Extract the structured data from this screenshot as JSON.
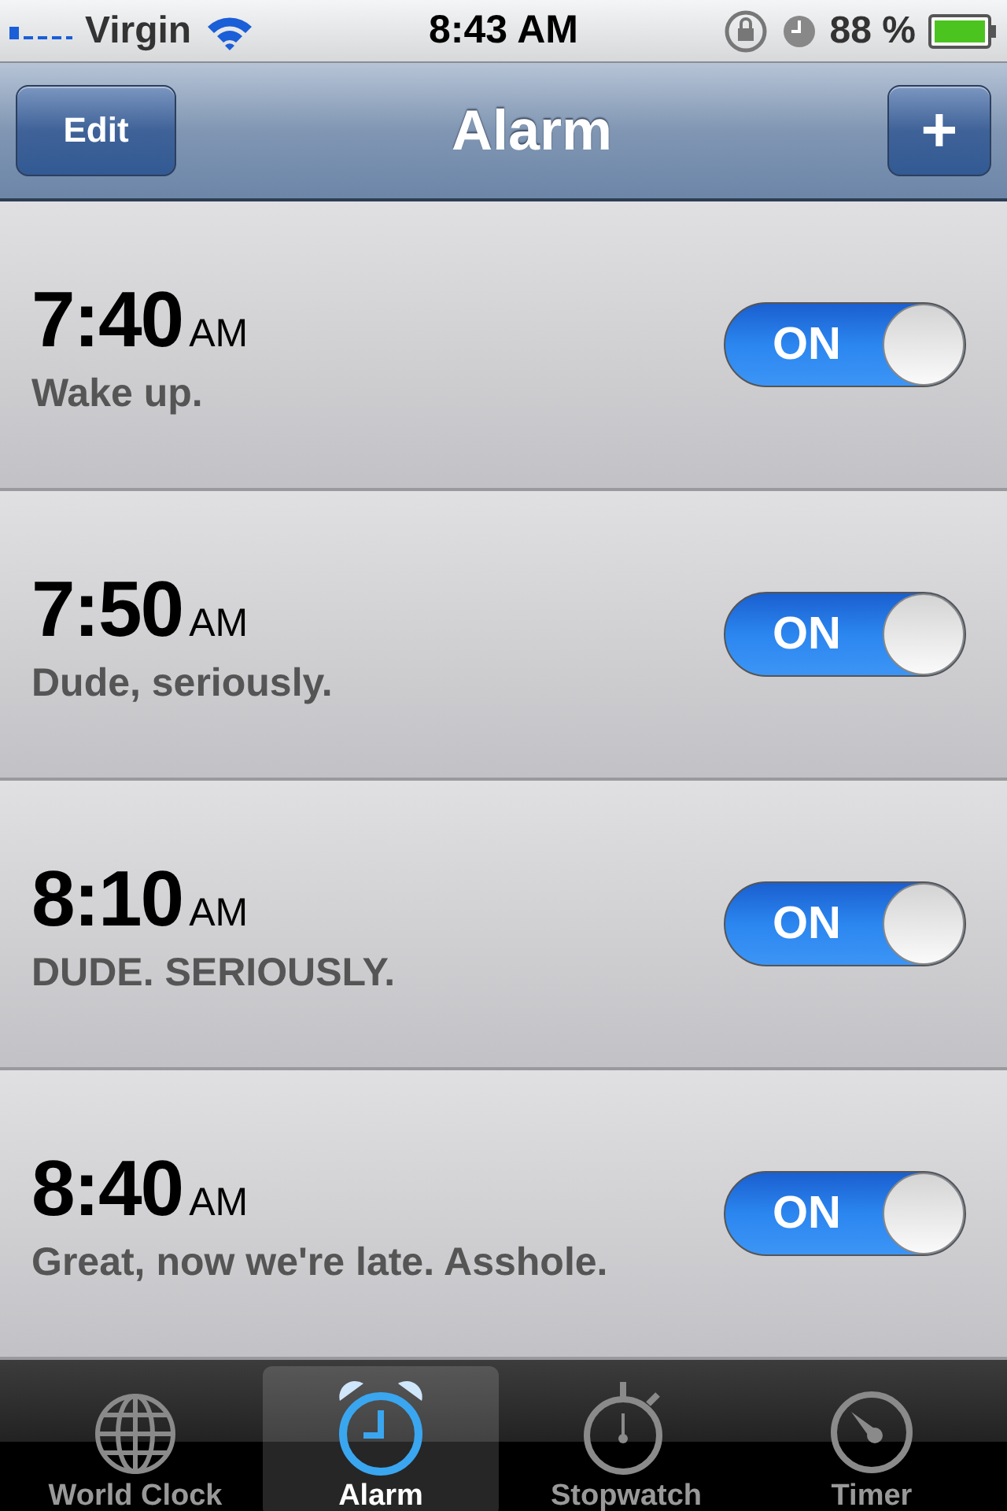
{
  "status_bar": {
    "carrier": "Virgin",
    "time": "8:43 AM",
    "battery": "88 %"
  },
  "nav_bar": {
    "edit_button": "Edit",
    "title": "Alarm",
    "add_button": "+"
  },
  "alarms": [
    {
      "time": "7:40",
      "period": "AM",
      "label": "Wake up.",
      "on": true,
      "switch_text": "ON"
    },
    {
      "time": "7:50",
      "period": "AM",
      "label": "Dude, seriously.",
      "on": true,
      "switch_text": "ON"
    },
    {
      "time": "8:10",
      "period": "AM",
      "label": "DUDE. SERIOUSLY.",
      "on": true,
      "switch_text": "ON"
    },
    {
      "time": "8:40",
      "period": "AM",
      "label": "Great, now we're late. Asshole.",
      "on": true,
      "switch_text": "ON"
    }
  ],
  "tabs": [
    {
      "kind": "globe",
      "label": "World Clock",
      "selected": false
    },
    {
      "kind": "alarm",
      "label": "Alarm",
      "selected": true
    },
    {
      "kind": "stopwatch",
      "label": "Stopwatch",
      "selected": false
    },
    {
      "kind": "timer",
      "label": "Timer",
      "selected": false
    }
  ]
}
